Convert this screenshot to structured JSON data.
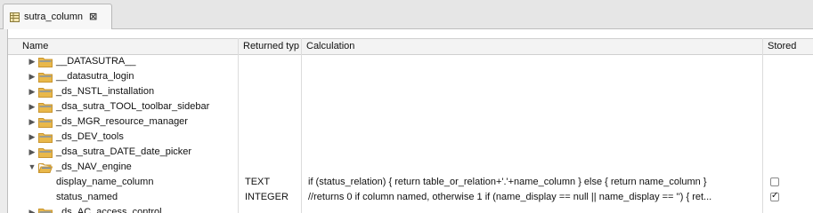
{
  "tab": {
    "title": "sutra_column",
    "close_glyph": "⊠",
    "icon": "table-icon"
  },
  "columns": {
    "name": "Name",
    "returned_type": "Returned typ",
    "calculation": "Calculation",
    "stored": "Stored"
  },
  "rows": [
    {
      "kind": "folder",
      "expanded": false,
      "name": "__DATASUTRA__"
    },
    {
      "kind": "folder",
      "expanded": false,
      "name": "__datasutra_login"
    },
    {
      "kind": "folder",
      "expanded": false,
      "name": "_ds_NSTL_installation"
    },
    {
      "kind": "folder",
      "expanded": false,
      "name": "_dsa_sutra_TOOL_toolbar_sidebar"
    },
    {
      "kind": "folder",
      "expanded": false,
      "name": "_ds_MGR_resource_manager"
    },
    {
      "kind": "folder",
      "expanded": false,
      "name": "_ds_DEV_tools"
    },
    {
      "kind": "folder",
      "expanded": false,
      "name": "_dsa_sutra_DATE_date_picker"
    },
    {
      "kind": "folder",
      "expanded": true,
      "name": "_ds_NAV_engine"
    },
    {
      "kind": "calc",
      "name": "display_name_column",
      "type": "TEXT",
      "calculation": "if (status_relation) {  return table_or_relation+'.'+name_column } else { return name_column }",
      "stored": false
    },
    {
      "kind": "calc",
      "name": "status_named",
      "type": "INTEGER",
      "calculation": "//returns 0 if column named, otherwise 1  if (name_display == null || name_display == '') { ret...",
      "stored": true
    },
    {
      "kind": "folder",
      "expanded": false,
      "name": "_ds_AC_access_control"
    }
  ],
  "colors": {
    "folder": "#e9b84a",
    "folder_dark": "#c9952e"
  }
}
